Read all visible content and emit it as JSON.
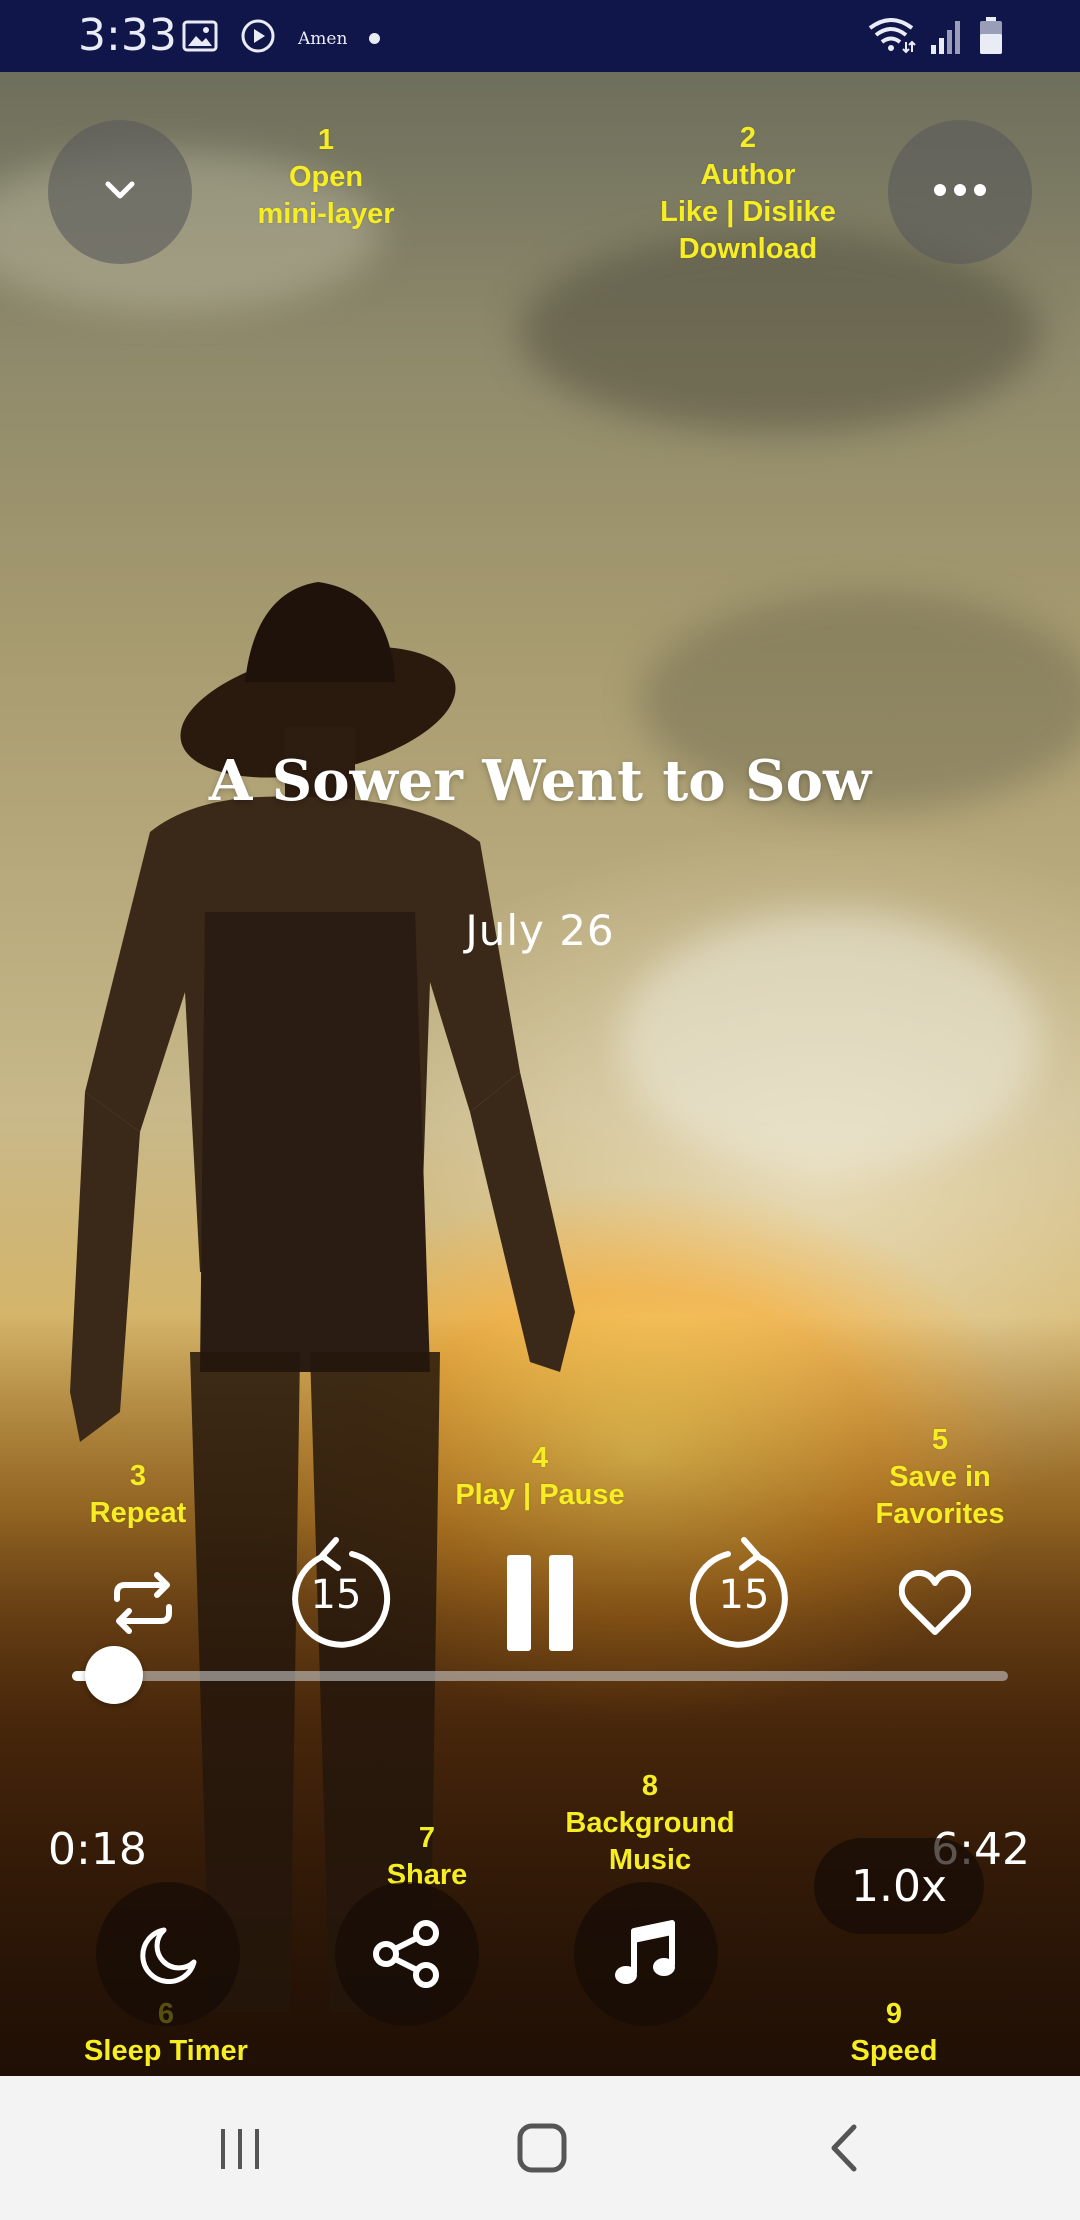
{
  "status_bar": {
    "time": "3:33",
    "app_label": "Amen",
    "icons": [
      "image-icon",
      "play-circle-icon",
      "notification-dot",
      "wifi-icon",
      "signal-icon",
      "battery-icon"
    ]
  },
  "player": {
    "title": "A Sower Went to Sow",
    "date": "July 26",
    "elapsed": "0:18",
    "duration": "6:42",
    "progress_fraction": 0.045,
    "speed": "1.0x",
    "skip_back_seconds": "15",
    "skip_forward_seconds": "15"
  },
  "annotations": {
    "open_mini_layer": "1\nOpen\nmini-layer",
    "menu": "2\nAuthor\nLike | Dislike\nDownload",
    "repeat": "3\nRepeat",
    "play_pause": "4\nPlay | Pause",
    "favorites": "5\nSave in\nFavorites",
    "sleep_timer": "6\nSleep Timer",
    "share": "7\nShare",
    "background_music": "8\nBackground\nMusic",
    "speed": "9\nSpeed"
  },
  "colors": {
    "status_bar_bg": "#11164a",
    "annotation_text": "#f6ee22",
    "nav_bar_bg": "#f3f3f3"
  }
}
